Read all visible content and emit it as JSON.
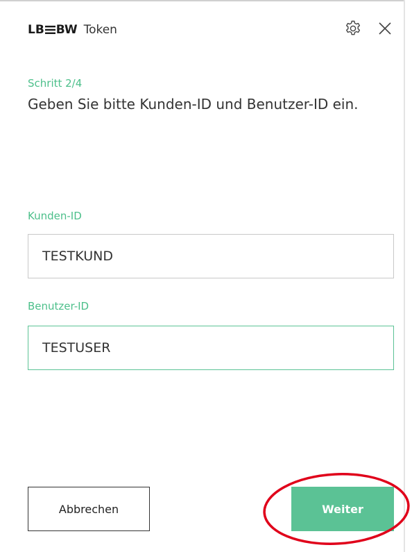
{
  "header": {
    "brand_logo": "LB≡BW",
    "brand_name": "Token",
    "icons": [
      "gear-icon",
      "close-icon"
    ]
  },
  "step": {
    "label": "Schritt 2/4",
    "instruction": "Geben Sie bitte Kunden-ID und Benutzer-ID ein."
  },
  "fields": {
    "kunden_id": {
      "label": "Kunden-ID",
      "value": "TESTKUND"
    },
    "benutzer_id": {
      "label": "Benutzer-ID",
      "value": "TESTUSER"
    }
  },
  "buttons": {
    "cancel_label": "Abbrechen",
    "next_label": "Weiter"
  },
  "colors": {
    "accent": "#5bc295",
    "label_green": "#4cbf8a",
    "highlight_red": "#e0001a"
  }
}
